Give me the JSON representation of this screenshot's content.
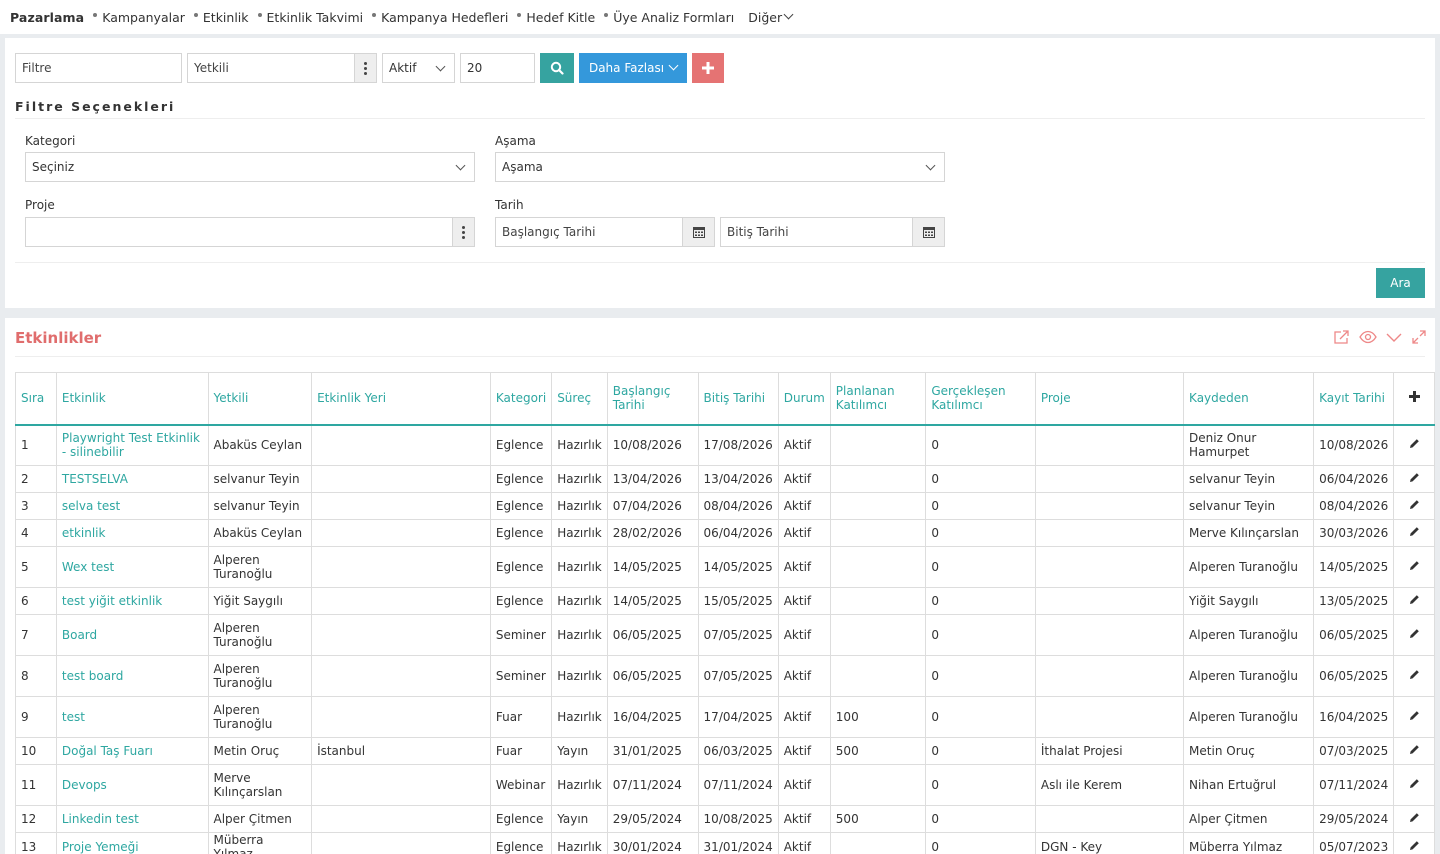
{
  "nav": {
    "brand": "Pazarlama",
    "items": [
      "Kampanyalar",
      "Etkinlik",
      "Etkinlik Takvimi",
      "Kampanya Hedefleri",
      "Hedef Kitle",
      "Üye Analiz Formları"
    ],
    "more_label": "Diğer"
  },
  "filters": {
    "filter_placeholder": "Filtre",
    "yetkili_placeholder": "Yetkili",
    "status_value": "Aktif",
    "count_value": "20",
    "more_button": "Daha Fazlası",
    "section_title": "Filtre Seçenekleri",
    "kategori_label": "Kategori",
    "kategori_value": "Seçiniz",
    "asama_label": "Aşama",
    "asama_value": "Aşama",
    "proje_label": "Proje",
    "proje_value": "",
    "tarih_label": "Tarih",
    "start_placeholder": "Başlangıç Tarihi",
    "end_placeholder": "Bitiş Tarihi",
    "search_button": "Ara"
  },
  "list": {
    "title": "Etkinlikler",
    "columns": [
      "Sıra",
      "Etkinlik",
      "Yetkili",
      "Etkinlik Yeri",
      "Kategori",
      "Süreç",
      "Başlangıç Tarihi",
      "Bitiş Tarihi",
      "Durum",
      "Planlanan Katılımcı",
      "Gerçekleşen Katılımcı",
      "Proje",
      "Kaydeden",
      "Kayıt Tarihi"
    ],
    "rows": [
      [
        "1",
        "Playwright Test Etkinlik - silinebilir",
        "Abaküs Ceylan",
        "",
        "Eglence",
        "Hazırlık",
        "10/08/2026",
        "17/08/2026",
        "Aktif",
        "",
        "0",
        "",
        "Deniz Onur Hamurpet",
        "10/08/2026"
      ],
      [
        "2",
        "TESTSELVA",
        "selvanur Teyin",
        "",
        "Eglence",
        "Hazırlık",
        "13/04/2026",
        "13/04/2026",
        "Aktif",
        "",
        "0",
        "",
        "selvanur Teyin",
        "06/04/2026"
      ],
      [
        "3",
        "selva test",
        "selvanur Teyin",
        "",
        "Eglence",
        "Hazırlık",
        "07/04/2026",
        "08/04/2026",
        "Aktif",
        "",
        "0",
        "",
        "selvanur Teyin",
        "08/04/2026"
      ],
      [
        "4",
        "etkinlik",
        "Abaküs Ceylan",
        "",
        "Eglence",
        "Hazırlık",
        "28/02/2026",
        "06/04/2026",
        "Aktif",
        "",
        "0",
        "",
        "Merve Kılınçarslan",
        "30/03/2026"
      ],
      [
        "5",
        "Wex test",
        "Alperen Turanoğlu",
        "",
        "Eglence",
        "Hazırlık",
        "14/05/2025",
        "14/05/2025",
        "Aktif",
        "",
        "0",
        "",
        "Alperen Turanoğlu",
        "14/05/2025"
      ],
      [
        "6",
        "test yiğit etkinlik",
        "Yiğit Saygılı",
        "",
        "Eglence",
        "Hazırlık",
        "14/05/2025",
        "15/05/2025",
        "Aktif",
        "",
        "0",
        "",
        "Yiğit Saygılı",
        "13/05/2025"
      ],
      [
        "7",
        "Board",
        "Alperen Turanoğlu",
        "",
        "Seminer",
        "Hazırlık",
        "06/05/2025",
        "07/05/2025",
        "Aktif",
        "",
        "0",
        "",
        "Alperen Turanoğlu",
        "06/05/2025"
      ],
      [
        "8",
        "test board",
        "Alperen Turanoğlu",
        "",
        "Seminer",
        "Hazırlık",
        "06/05/2025",
        "07/05/2025",
        "Aktif",
        "",
        "0",
        "",
        "Alperen Turanoğlu",
        "06/05/2025"
      ],
      [
        "9",
        "test",
        "Alperen Turanoğlu",
        "",
        "Fuar",
        "Hazırlık",
        "16/04/2025",
        "17/04/2025",
        "Aktif",
        "100",
        "0",
        "",
        "Alperen Turanoğlu",
        "16/04/2025"
      ],
      [
        "10",
        "Doğal Taş Fuarı",
        "Metin Oruç",
        "İstanbul",
        "Fuar",
        "Yayın",
        "31/01/2025",
        "06/03/2025",
        "Aktif",
        "500",
        "0",
        "İthalat Projesi",
        "Metin Oruç",
        "07/03/2025"
      ],
      [
        "11",
        "Devops",
        "Merve Kılınçarslan",
        "",
        "Webinar",
        "Hazırlık",
        "07/11/2024",
        "07/11/2024",
        "Aktif",
        "",
        "0",
        "Aslı ile Kerem",
        "Nihan Ertuğrul",
        "07/11/2024"
      ],
      [
        "12",
        "Linkedin test",
        "Alper Çitmen",
        "",
        "Eglence",
        "Yayın",
        "29/05/2024",
        "10/08/2025",
        "Aktif",
        "500",
        "0",
        "",
        "Alper Çitmen",
        "29/05/2024"
      ],
      [
        "13",
        "Proje Yemeği",
        "Müberra Yılmaz",
        "",
        "Eglence",
        "Hazırlık",
        "30/01/2024",
        "31/01/2024",
        "Aktif",
        "",
        "0",
        "DGN - Key",
        "Müberra Yılmaz",
        "05/07/2023"
      ]
    ],
    "row_heights": [
      "h2",
      "h1",
      "h1",
      "h1",
      "h2",
      "h1",
      "h2",
      "h2",
      "h2",
      "h1",
      "h2",
      "h1",
      "h1"
    ]
  },
  "colors": {
    "accent": "#36a3a0",
    "link": "#2ea7a1",
    "primary": "#3498db",
    "danger": "#e57373",
    "title": "#e06d6d"
  },
  "icons": [
    "search-icon",
    "plus-icon",
    "kebab-icon",
    "calendar-icon",
    "chevron-down-icon",
    "export-icon",
    "eye-icon",
    "collapse-icon",
    "expand-icon",
    "edit-icon"
  ]
}
